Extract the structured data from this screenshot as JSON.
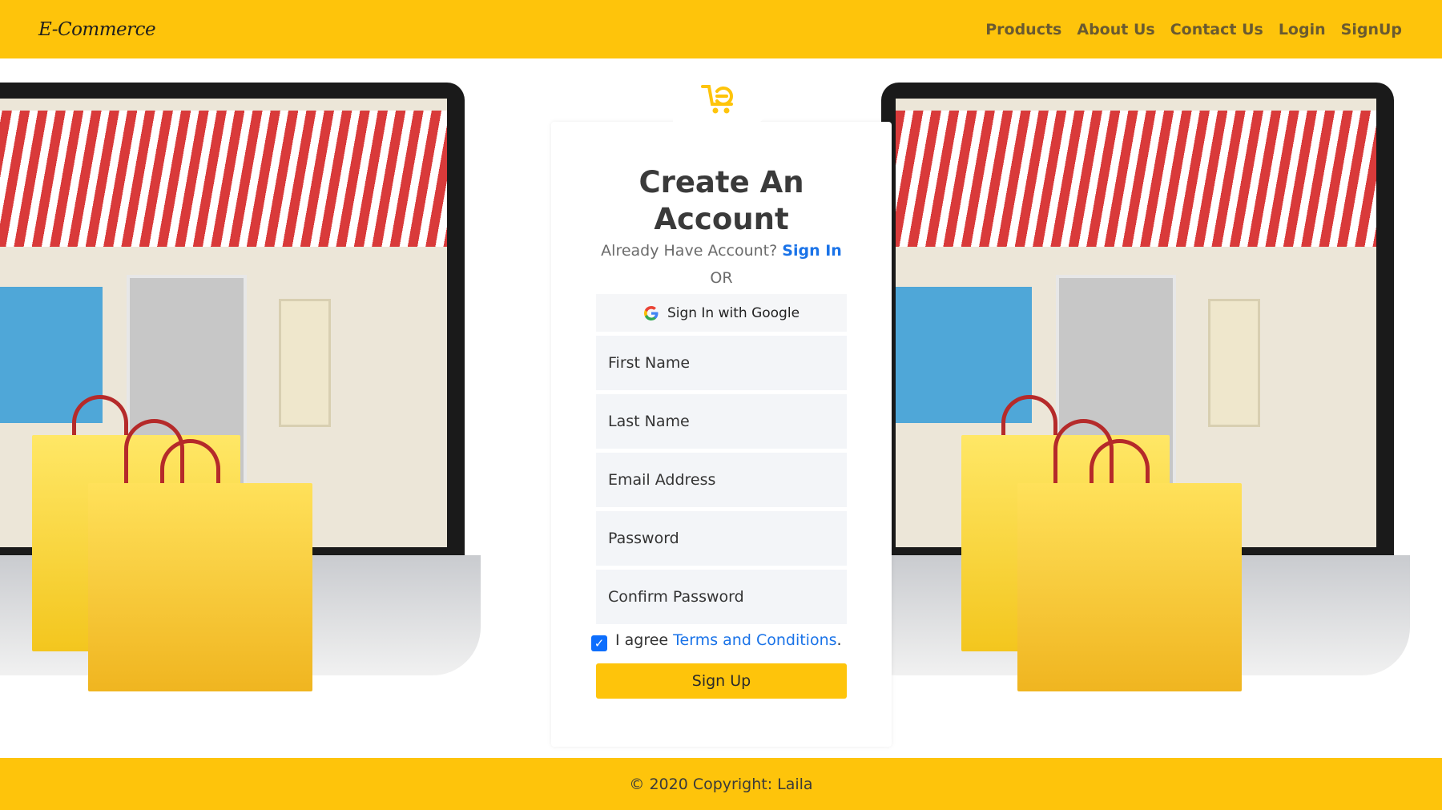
{
  "navbar": {
    "brand": "E-Commerce",
    "links": [
      "Products",
      "About Us",
      "Contact Us",
      "Login",
      "SignUp"
    ]
  },
  "signup": {
    "title_line1": "Create An",
    "title_line2": "Account",
    "have_account_text": "Already Have Account?",
    "sign_in_link": "Sign In",
    "or_text": "OR",
    "google_button": "Sign In with Google",
    "fields": {
      "first_name": "First Name",
      "last_name": "Last Name",
      "email": "Email Address",
      "password": "Password",
      "confirm_password": "Confirm Password"
    },
    "agree_text": "I agree",
    "terms_link": "Terms and Conditions",
    "terms_period": ".",
    "submit": "Sign Up"
  },
  "footer": {
    "copyright": "© 2020 Copyright: Laila"
  },
  "colors": {
    "accent": "#fec40b",
    "link": "#1a73e8",
    "checkbox": "#0d6efd"
  }
}
